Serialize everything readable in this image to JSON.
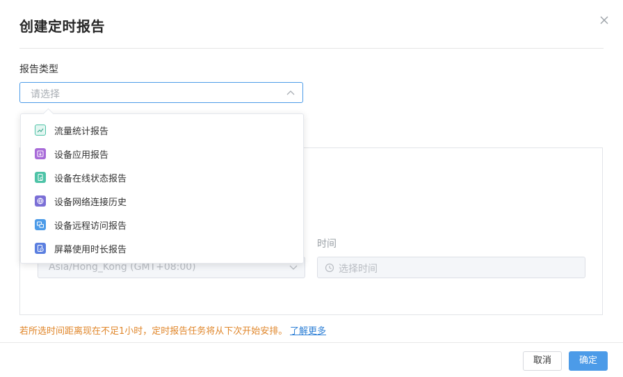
{
  "dialog": {
    "title": "创建定时报告",
    "report_type_label": "报告类型",
    "select_placeholder": "请选择",
    "timezone_value": "Asia/Hong_Kong (GMT+08:00)",
    "time_label": "时间",
    "time_placeholder": "选择时间",
    "warning": "若所选时间距离现在不足1小时，定时报告任务将从下次开始安排。",
    "learn_more": "了解更多",
    "cancel_label": "取消",
    "ok_label": "确定"
  },
  "dropdown": {
    "options": [
      {
        "label": "流量统计报告",
        "icon": "line-chart-icon",
        "color": "#4ec3a7"
      },
      {
        "label": "设备应用报告",
        "icon": "app-download-icon",
        "color": "#a86bd8"
      },
      {
        "label": "设备在线状态报告",
        "icon": "device-status-icon",
        "color": "#4ec3a7"
      },
      {
        "label": "设备网络连接历史",
        "icon": "network-icon",
        "color": "#7b6fd6"
      },
      {
        "label": "设备远程访问报告",
        "icon": "remote-access-icon",
        "color": "#4c9be8"
      },
      {
        "label": "屏幕使用时长报告",
        "icon": "screen-time-icon",
        "color": "#5b7fe0"
      }
    ]
  },
  "colors": {
    "accent": "#4c9be8",
    "warning": "#e0862a",
    "link": "#2f80d6"
  }
}
